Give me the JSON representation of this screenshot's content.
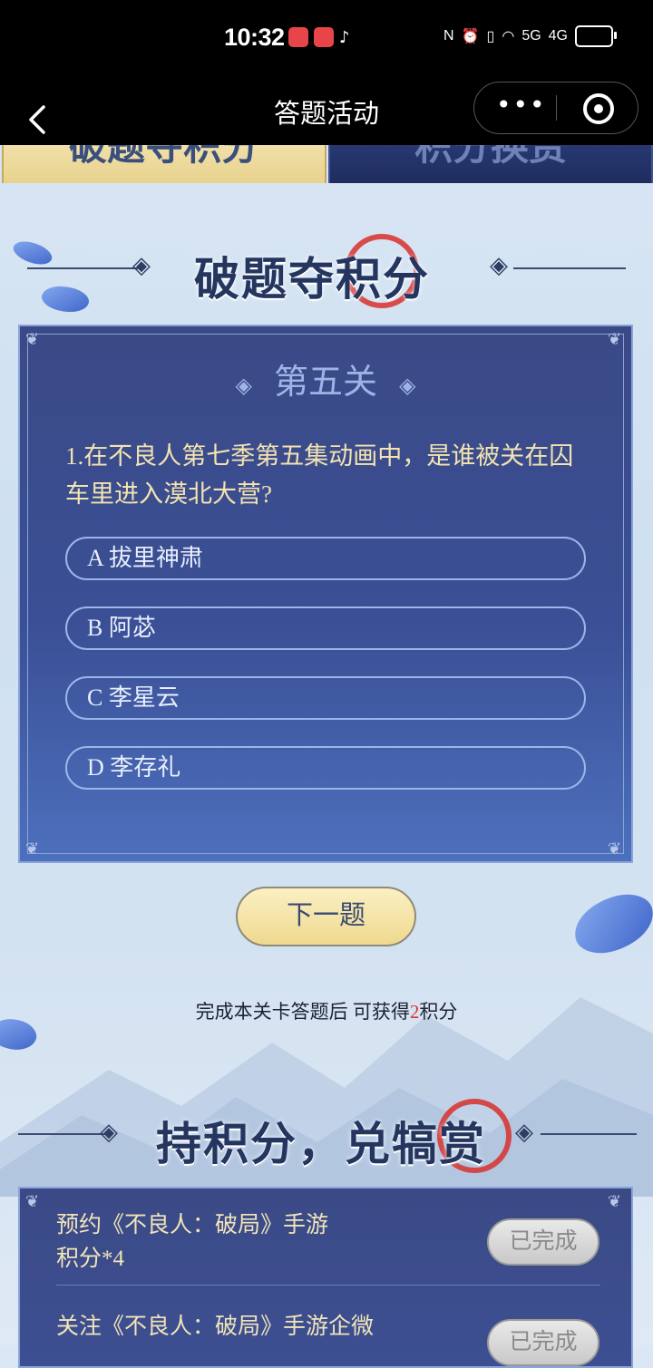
{
  "status_bar": {
    "time": "10:32",
    "network": "5G",
    "network2": "4G"
  },
  "nav": {
    "back_icon": "chevron-left-icon",
    "title": "答题活动",
    "more": "•••"
  },
  "tabs": [
    {
      "label": "破题夺积分"
    },
    {
      "label": "积分换赏"
    }
  ],
  "quiz_section": {
    "title": "破题夺积分",
    "level": "第五关",
    "question": "1.在不良人第七季第五集动画中，是谁被关在囚车里进入漠北大营?",
    "options": [
      {
        "letter": "A",
        "text": "拔里神肃"
      },
      {
        "letter": "B",
        "text": "阿苾"
      },
      {
        "letter": "C",
        "text": "李星云"
      },
      {
        "letter": "D",
        "text": "李存礼"
      }
    ],
    "next_button": "下一题",
    "reward_prefix": "完成本关卡答题后 可获得",
    "reward_points": "2",
    "reward_suffix": "积分"
  },
  "exchange_section": {
    "title": "持积分，兑犒赏",
    "tasks": [
      {
        "line1": "预约《不良人：破局》手游",
        "line2": "积分*4",
        "status": "已完成"
      },
      {
        "line1": "关注《不良人：破局》手游企微",
        "line2": "",
        "status": "已完成"
      }
    ]
  },
  "colors": {
    "panel": "#3b4a86",
    "gold_text": "#f3e3b0",
    "accent_red": "#e03131",
    "button_gold": "#efd98f"
  }
}
